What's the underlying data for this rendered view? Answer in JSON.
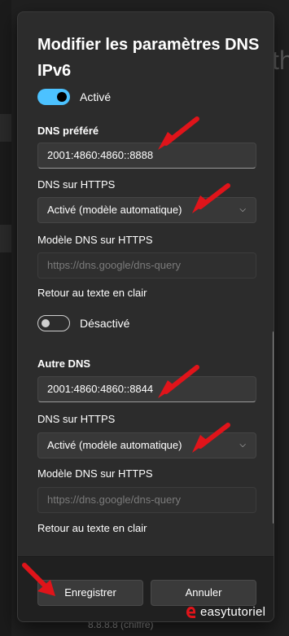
{
  "dialog": {
    "title": "Modifier les paramètres DNS IPv6",
    "ipv6_toggle": {
      "state": "on",
      "label": "Activé"
    },
    "preferred": {
      "heading": "DNS préféré",
      "value": "2001:4860:4860::8888",
      "https_label": "DNS sur HTTPS",
      "https_value": "Activé (modèle automatique)",
      "template_label": "Modèle DNS sur HTTPS",
      "template_placeholder": "https://dns.google/dns-query",
      "fallback_label": "Retour au texte en clair",
      "fallback_toggle": {
        "state": "off",
        "label": "Désactivé"
      }
    },
    "alternate": {
      "heading": "Autre DNS",
      "value": "2001:4860:4860::8844",
      "https_label": "DNS sur HTTPS",
      "https_value": "Activé (modèle automatique)",
      "template_label": "Modèle DNS sur HTTPS",
      "template_placeholder": "https://dns.google/dns-query",
      "fallback_label": "Retour au texte en clair"
    },
    "buttons": {
      "save": "Enregistrer",
      "cancel": "Annuler"
    }
  },
  "background": {
    "bottom_text": "8.8.8.8 (chiffré)"
  },
  "watermark": "easytutoriel",
  "colors": {
    "accent": "#4cc2ff",
    "arrow": "#e0141a",
    "dialog_bg": "#2c2c2c"
  },
  "icons": [
    "chevron-down-icon",
    "red-arrow-annotation",
    "search-icon"
  ]
}
